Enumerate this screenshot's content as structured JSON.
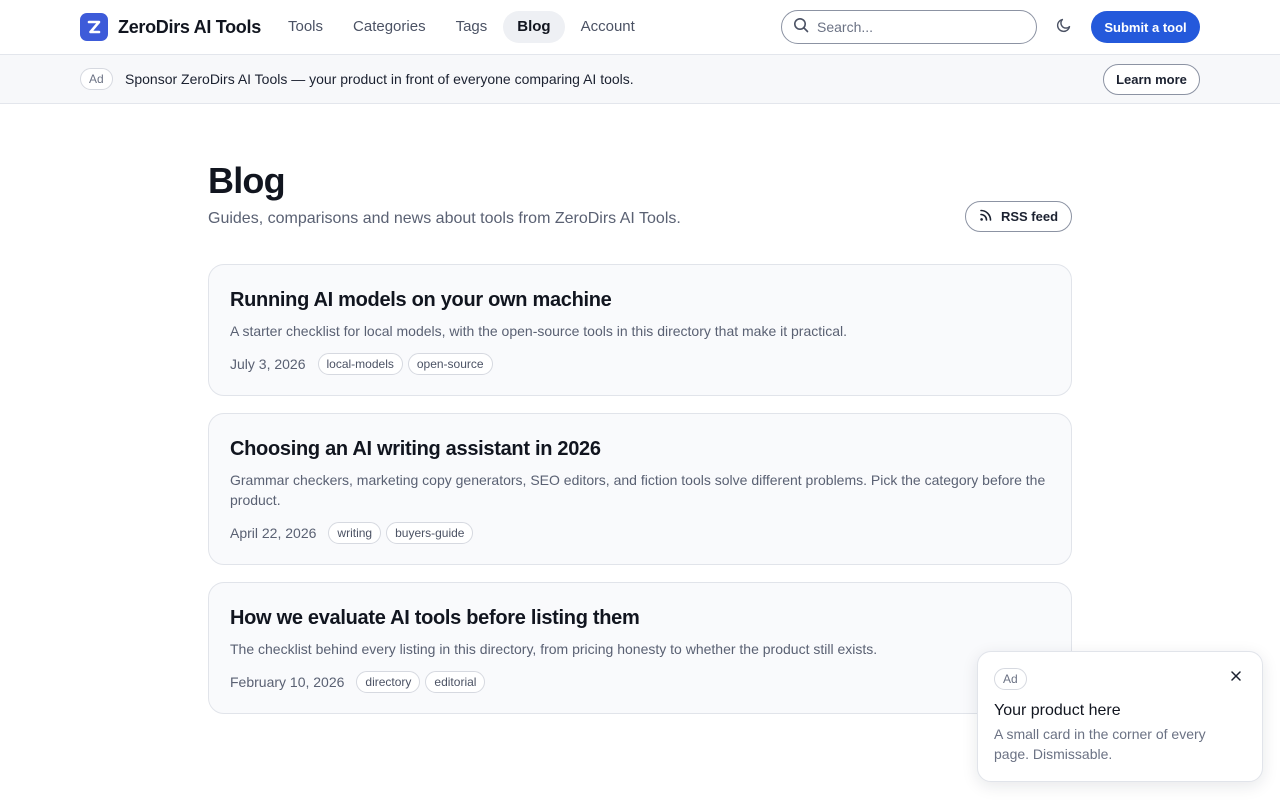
{
  "header": {
    "brand": "ZeroDirs AI Tools",
    "logo_letter": "Z",
    "nav": [
      {
        "label": "Tools",
        "active": false
      },
      {
        "label": "Categories",
        "active": false
      },
      {
        "label": "Tags",
        "active": false
      },
      {
        "label": "Blog",
        "active": true
      },
      {
        "label": "Account",
        "active": false
      }
    ],
    "search_placeholder": "Search...",
    "submit_label": "Submit a tool"
  },
  "ad_banner": {
    "badge": "Ad",
    "text": "Sponsor ZeroDirs AI Tools — your product in front of everyone comparing AI tools.",
    "button": "Learn more"
  },
  "main": {
    "title": "Blog",
    "subtitle": "Guides, comparisons and news about tools from ZeroDirs AI Tools.",
    "rss_label": "RSS feed",
    "posts": [
      {
        "title": "Running AI models on your own machine",
        "excerpt": "A starter checklist for local models, with the open-source tools in this directory that make it practical.",
        "date": "July 3, 2026",
        "tags": [
          "local-models",
          "open-source"
        ]
      },
      {
        "title": "Choosing an AI writing assistant in 2026",
        "excerpt": "Grammar checkers, marketing copy generators, SEO editors, and fiction tools solve different problems. Pick the category before the product.",
        "date": "April 22, 2026",
        "tags": [
          "writing",
          "buyers-guide"
        ]
      },
      {
        "title": "How we evaluate AI tools before listing them",
        "excerpt": "The checklist behind every listing in this directory, from pricing honesty to whether the product still exists.",
        "date": "February 10, 2026",
        "tags": [
          "directory",
          "editorial"
        ]
      }
    ]
  },
  "float_ad": {
    "badge": "Ad",
    "title": "Your product here",
    "body": "A small card in the corner of every page. Dismissable."
  },
  "colors": {
    "accent": "#2459db",
    "logo": "#3d5bd9"
  },
  "icons": [
    "logo-icon",
    "search-icon",
    "moon-icon",
    "rss-icon",
    "close-icon"
  ]
}
